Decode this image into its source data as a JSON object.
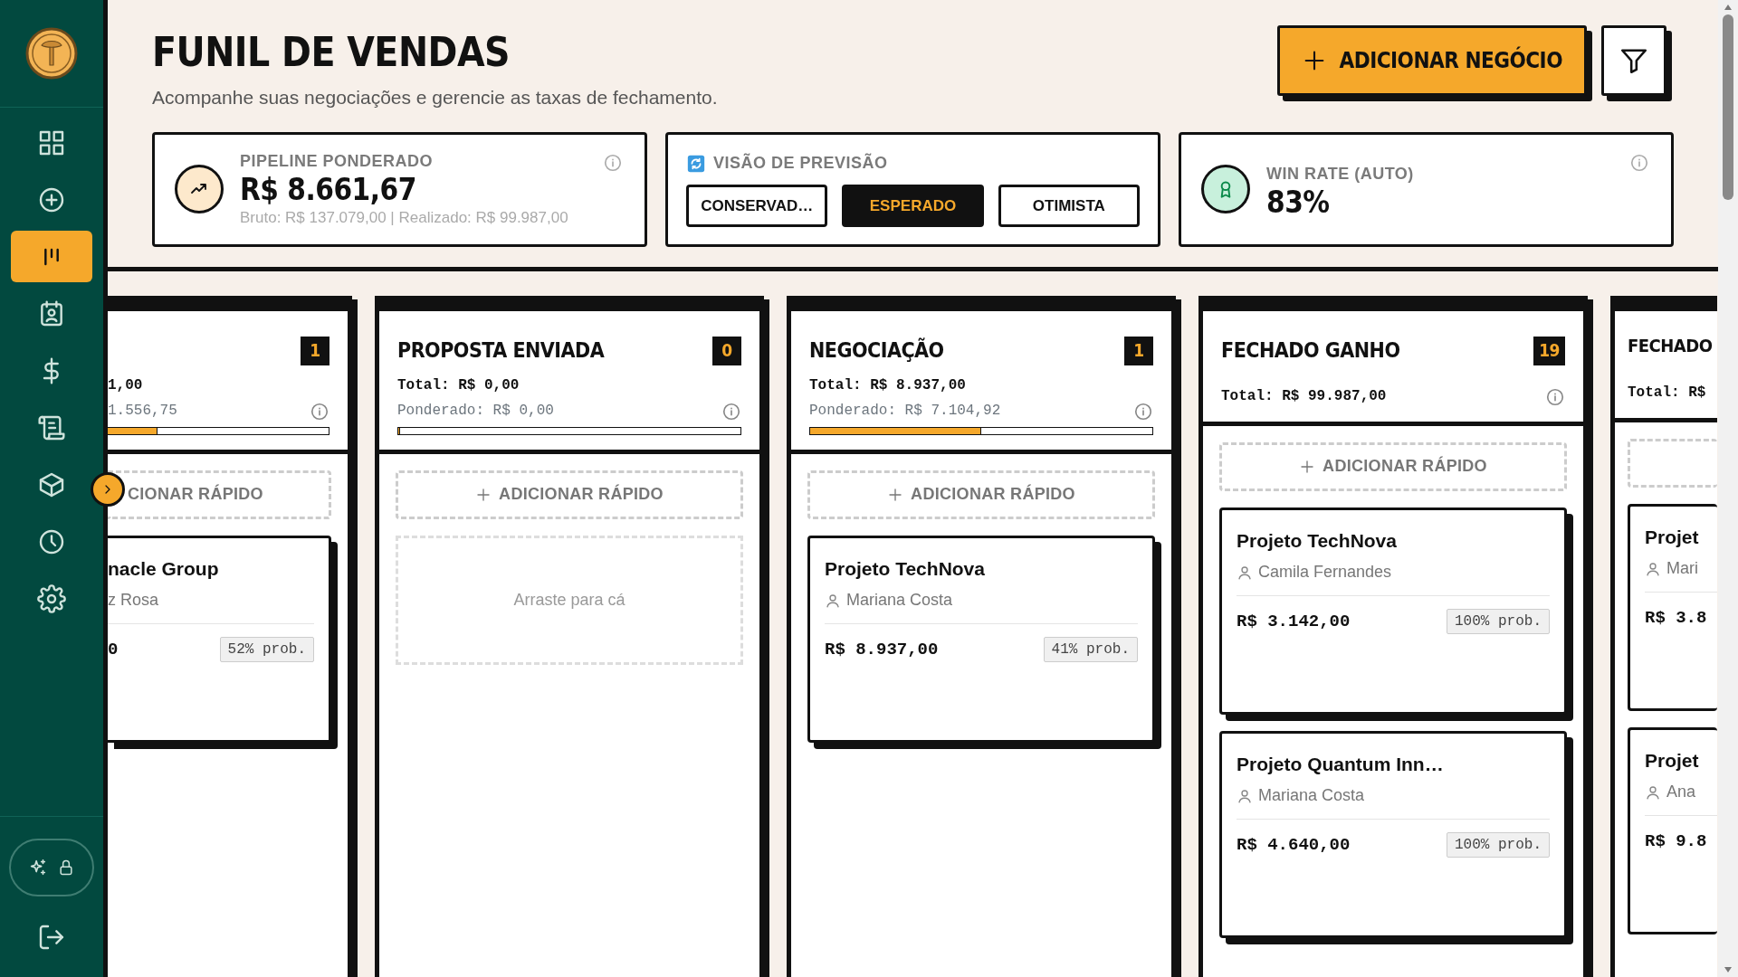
{
  "sidebar": {
    "nav": [
      {
        "selected": false
      },
      {
        "selected": false
      },
      {
        "selected": true
      },
      {
        "selected": false
      },
      {
        "selected": false
      },
      {
        "selected": false
      },
      {
        "selected": false
      },
      {
        "selected": false
      },
      {
        "selected": false
      }
    ]
  },
  "header": {
    "title": "FUNIL DE VENDAS",
    "subtitle": "Acompanhe suas negociações e gerencie as taxas de fechamento.",
    "add_button": "ADICIONAR NEGÓCIO"
  },
  "stats": [
    {
      "kind": "metric",
      "label": "PIPELINE PONDERADO",
      "value": "R$ 8.661,67",
      "detail": "Bruto: R$ 137.079,00 | Realizado: R$ 99.987,00"
    },
    {
      "kind": "forecast",
      "label": "VISÃO DE PREVISÃO",
      "options": [
        {
          "label": "CONSERVAD…",
          "selected": false
        },
        {
          "label": "ESPERADO",
          "selected": true
        },
        {
          "label": "OTIMISTA",
          "selected": false
        }
      ]
    },
    {
      "kind": "metric",
      "label": "WIN RATE (AUTO)",
      "value": "83%"
    }
  ],
  "columns": [
    {
      "kind": "cut_left",
      "count": "1",
      "total": "1,00",
      "weighted": "1.556,75",
      "level": 0.5,
      "quick_add": "CIONAR RÁPIDO",
      "cards": [
        {
          "title": "nacle Group",
          "owner": "z Rosa",
          "amount": "0",
          "probability": "52% prob."
        }
      ]
    },
    {
      "kind": "full",
      "title": "PROPOSTA ENVIADA",
      "count": "0",
      "total": "Total: R$ 0,00",
      "weighted": "Ponderado: R$ 0,00",
      "level": 0,
      "quick_add": "ADICIONAR RÁPIDO",
      "drop_hint": "Arraste para cá"
    },
    {
      "kind": "full",
      "title": "NEGOCIAÇÃO",
      "count": "1",
      "total": "Total: R$ 8.937,00",
      "weighted": "Ponderado: R$ 7.104,92",
      "level": 0.5,
      "quick_add": "ADICIONAR RÁPIDO",
      "cards": [
        {
          "title": "Projeto TechNova",
          "owner": "Mariana Costa",
          "amount": "R$ 8.937,00",
          "probability": "41% prob."
        }
      ]
    },
    {
      "kind": "full",
      "title": "FECHADO GANHO",
      "count": "19",
      "total": "Total: R$ 99.987,00",
      "quick_add": "ADICIONAR RÁPIDO",
      "cards": [
        {
          "title": "Projeto TechNova",
          "owner": "Camila Fernandes",
          "amount": "R$ 3.142,00",
          "probability": "100% prob."
        },
        {
          "title": "Projeto Quantum Inn…",
          "owner": "Mariana Costa",
          "amount": "R$ 4.640,00",
          "probability": "100% prob."
        }
      ]
    },
    {
      "kind": "cut_right",
      "title": "FECHADO",
      "total": "Total: R$",
      "cards": [
        {
          "title": "Projet",
          "owner": "Mari",
          "amount": "R$ 3.8"
        },
        {
          "title": "Projet",
          "owner": "Ana",
          "amount": "R$ 9.8"
        }
      ]
    }
  ]
}
